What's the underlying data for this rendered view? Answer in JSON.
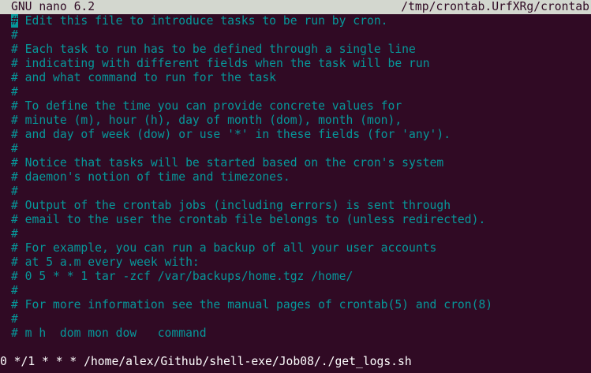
{
  "titlebar": {
    "app": "GNU nano 6.2",
    "file": "/tmp/crontab.UrfXRg/crontab"
  },
  "editor": {
    "cursor_char": "#",
    "first_line_rest": " Edit this file to introduce tasks to be run by cron.",
    "lines": [
      "#",
      "# Each task to run has to be defined through a single line",
      "# indicating with different fields when the task will be run",
      "# and what command to run for the task",
      "#",
      "# To define the time you can provide concrete values for",
      "# minute (m), hour (h), day of month (dom), month (mon),",
      "# and day of week (dow) or use '*' in these fields (for 'any').",
      "#",
      "# Notice that tasks will be started based on the cron's system",
      "# daemon's notion of time and timezones.",
      "#",
      "# Output of the crontab jobs (including errors) is sent through",
      "# email to the user the crontab file belongs to (unless redirected).",
      "#",
      "# For example, you can run a backup of all your user accounts",
      "# at 5 a.m every week with:",
      "# 0 5 * * 1 tar -zcf /var/backups/home.tgz /home/",
      "#",
      "# For more information see the manual pages of crontab(5) and cron(8)",
      "#",
      "# m h  dom mon dow   command"
    ],
    "job_line": "0 */1 * * * /home/alex/Github/shell-exe/Job08/./get_logs.sh"
  },
  "colors": {
    "background": "#300a24",
    "comment": "#06989a",
    "titlebar": "#d3d7cf",
    "text": "#ffffff"
  }
}
